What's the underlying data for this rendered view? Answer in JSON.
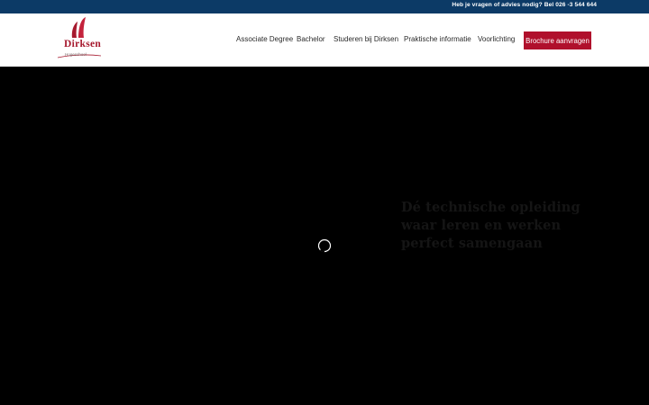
{
  "topbar": {
    "contact_text": "Heb je vragen of advies nodig? Bel 026 -3 544 644"
  },
  "logo": {
    "name": "Dirksen",
    "subtitle": "Hogeschool",
    "icon": "dirksen-logo-icon",
    "brand_color": "#a6192e"
  },
  "nav": {
    "items": [
      {
        "label": "Associate Degree"
      },
      {
        "label": "Bachelor"
      },
      {
        "label": "Studeren bij Dirksen"
      },
      {
        "label": "Praktische informatie"
      },
      {
        "label": "Voorlichting"
      }
    ],
    "cta_label": "Brochure aanvragen",
    "cta_color": "#b0102c"
  },
  "hero": {
    "title": "Dé technische opleiding waar leren en werken perfect samengaan",
    "loading_icon": "loading-spinner-icon",
    "background": "#000000"
  },
  "colors": {
    "topbar": "#0c3a66",
    "accent": "#b0102c"
  }
}
